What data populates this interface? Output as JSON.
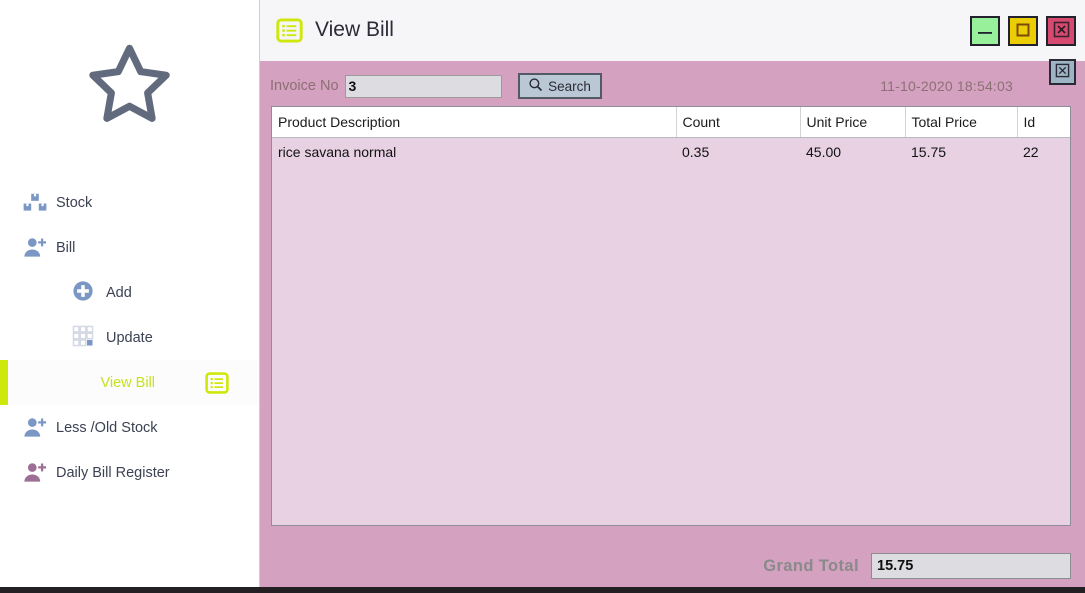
{
  "sidebar": {
    "logo_icon": "star-icon",
    "items": [
      {
        "label": "Stock",
        "icon": "boxes-icon",
        "active": false,
        "sub": false
      },
      {
        "label": "Bill",
        "icon": "user-add-icon",
        "active": false,
        "sub": false
      },
      {
        "label": "Add",
        "icon": "plus-circle-icon",
        "active": false,
        "sub": true
      },
      {
        "label": "Update",
        "icon": "grid-icon",
        "active": false,
        "sub": true
      },
      {
        "label": "View Bill",
        "icon": "list-icon",
        "active": true,
        "sub": true
      },
      {
        "label": "Less /Old Stock",
        "icon": "user-add-icon",
        "active": false,
        "sub": false
      },
      {
        "label": "Daily Bill Register",
        "icon": "user-add-purple-icon",
        "active": false,
        "sub": false
      }
    ]
  },
  "titlebar": {
    "icon": "list-icon",
    "title": "View Bill",
    "minimize_icon": "minimize-icon",
    "maximize_icon": "maximize-icon",
    "close_icon": "close-icon"
  },
  "toolbar": {
    "invoice_label": "Invoice No",
    "invoice_value": "3",
    "invoice_placeholder": "",
    "search_label": "Search",
    "search_icon": "magnifier-icon",
    "timestamp": "11-10-2020 18:54:03",
    "panel_close_icon": "close-box-icon"
  },
  "table": {
    "columns": [
      "Product Description",
      "Count",
      "Unit Price",
      "Total Price",
      "Id"
    ],
    "rows": [
      [
        "rice savana normal",
        "0.35",
        "45.00",
        "15.75",
        "22"
      ]
    ]
  },
  "footer": {
    "grand_total_label": "Grand Total",
    "grand_total_value": "15.75"
  },
  "colors": {
    "accent_green": "#cee80c",
    "panel_pink": "#d4a2c0",
    "grid_pink": "#e7d1e3",
    "icon_blue": "#7b97c4",
    "icon_purple": "#9e6f94",
    "minimize_green": "#99f09b",
    "maximize_yellow": "#eccd04",
    "close_red": "#d8496f"
  }
}
